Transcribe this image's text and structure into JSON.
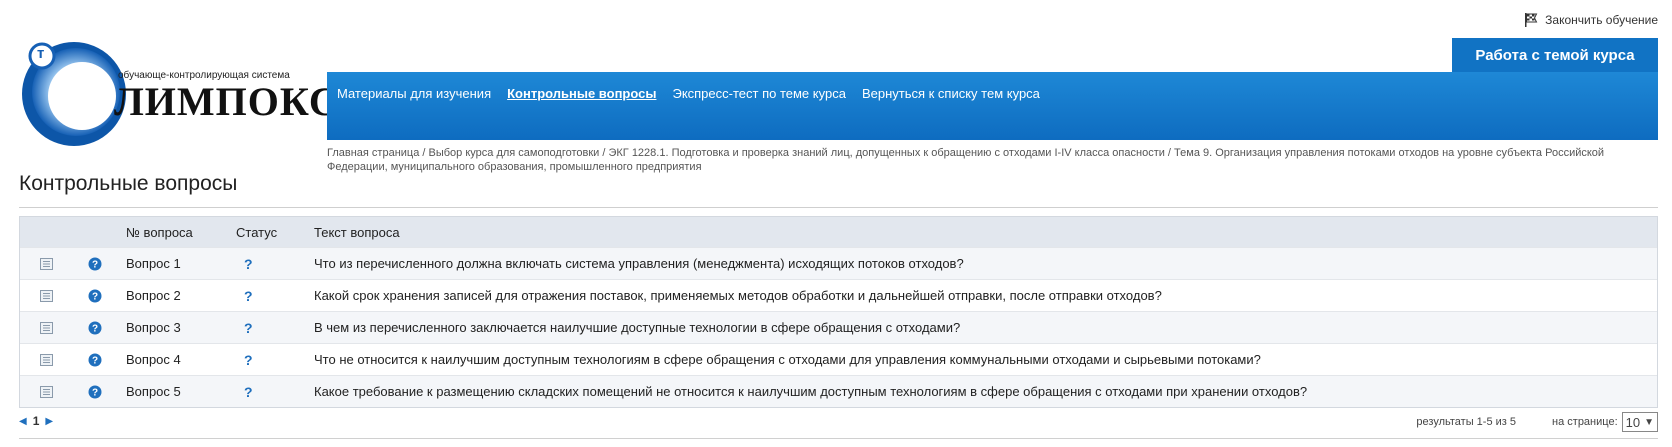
{
  "header": {
    "finish_label": "Закончить обучение",
    "logo_subtitle": "обучающе-контролирующая система",
    "logo_name": "ЛИМПОКС",
    "logo_badge": "т",
    "course_tab": "Работа с темой курса"
  },
  "nav": {
    "items": [
      {
        "label": "Материалы для изучения",
        "active": false
      },
      {
        "label": "Контрольные вопросы",
        "active": true
      },
      {
        "label": "Экспресс-тест по теме курса",
        "active": false
      },
      {
        "label": "Вернуться к списку тем курса",
        "active": false
      }
    ]
  },
  "breadcrumb": "Главная страница  /  Выбор курса для самоподготовки  /  ЭКГ 1228.1. Подготовка и проверка знаний лиц, допущенных к обращению с отходами I-IV класса опасности  /  Тема 9. Организация управления потоками отходов на уровне субъекта Российской Федерации, муниципального образования, промышленного предприятия",
  "page_title": "Контрольные вопросы",
  "table": {
    "headers": [
      "№ вопроса",
      "Статус",
      "Текст вопроса"
    ],
    "rows": [
      {
        "num": "Вопрос 1",
        "status": "?",
        "text": "Что из перечисленного должна включать система управления (менеджмента) исходящих потоков отходов?"
      },
      {
        "num": "Вопрос 2",
        "status": "?",
        "text": "Какой срок хранения записей для отражения поставок, применяемых методов обработки и дальнейшей отправки, после отправки отходов?"
      },
      {
        "num": "Вопрос 3",
        "status": "?",
        "text": "В чем из перечисленного заключается наилучшие доступные технологии в сфере обращения с отходами?"
      },
      {
        "num": "Вопрос 4",
        "status": "?",
        "text": "Что не относится к наилучшим доступным технологиям в сфере обращения с отходами для управления коммунальными отходами и сырьевыми потоками?"
      },
      {
        "num": "Вопрос 5",
        "status": "?",
        "text": "Какое требование к размещению складских помещений не относится к наилучшим доступным технологиям в сфере обращения с отходами при хранении отходов?"
      }
    ]
  },
  "pager": {
    "page": "1",
    "results": "результаты 1-5 из 5",
    "per_page_label": "на странице:",
    "per_page_value": "10"
  },
  "colors": {
    "accent": "#1173c4",
    "nav": "#1e88d6"
  }
}
